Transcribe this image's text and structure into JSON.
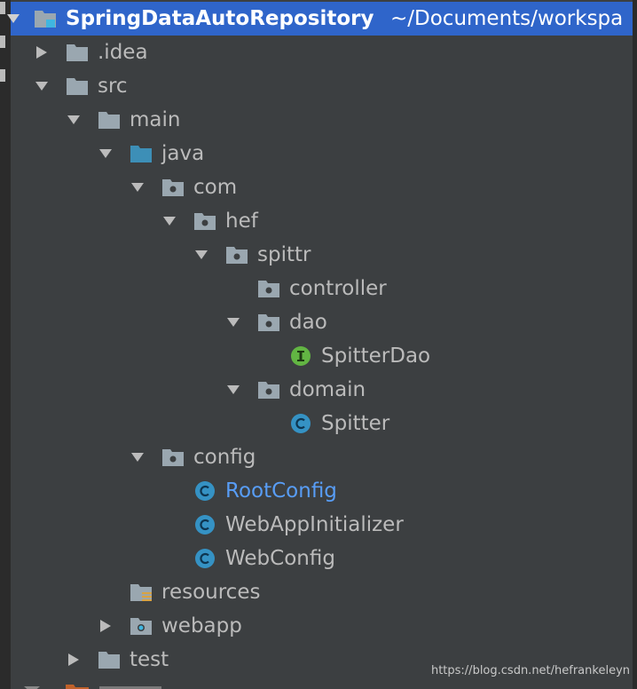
{
  "project": {
    "name": "SpringDataAutoRepository",
    "path": "~/Documents/workspa"
  },
  "tree": [
    {
      "label": ".idea",
      "icon": "folder-icon",
      "expanded": false
    },
    {
      "label": "src",
      "icon": "folder-icon",
      "expanded": true
    },
    {
      "label": "main",
      "icon": "folder-icon",
      "expanded": true
    },
    {
      "label": "java",
      "icon": "source-folder-icon",
      "expanded": true
    },
    {
      "label": "com",
      "icon": "package-icon",
      "expanded": true
    },
    {
      "label": "hef",
      "icon": "package-icon",
      "expanded": true
    },
    {
      "label": "spittr",
      "icon": "package-icon",
      "expanded": true
    },
    {
      "label": "controller",
      "icon": "package-icon"
    },
    {
      "label": "dao",
      "icon": "package-icon",
      "expanded": true
    },
    {
      "label": "SpitterDao",
      "icon": "interface-icon"
    },
    {
      "label": "domain",
      "icon": "package-icon",
      "expanded": true
    },
    {
      "label": "Spitter",
      "icon": "class-icon"
    },
    {
      "label": "config",
      "icon": "package-icon",
      "expanded": true
    },
    {
      "label": "RootConfig",
      "icon": "class-icon",
      "modified": true
    },
    {
      "label": "WebAppInitializer",
      "icon": "class-icon"
    },
    {
      "label": "WebConfig",
      "icon": "class-icon"
    },
    {
      "label": "resources",
      "icon": "resources-folder-icon"
    },
    {
      "label": "webapp",
      "icon": "web-folder-icon",
      "expanded": false
    },
    {
      "label": "test",
      "icon": "folder-icon",
      "expanded": false
    }
  ],
  "watermark": "https://blog.csdn.net/hefrankeleyn",
  "colors": {
    "background": "#3c3f41",
    "selection": "#2f65ca",
    "text": "#bbbbbb",
    "modified_text": "#589df6",
    "folder": "#9aa7b0",
    "source_folder": "#3d8fb7",
    "class_icon": "#40b6e0",
    "interface_icon": "#62b543",
    "resources_marker": "#d9a343"
  }
}
